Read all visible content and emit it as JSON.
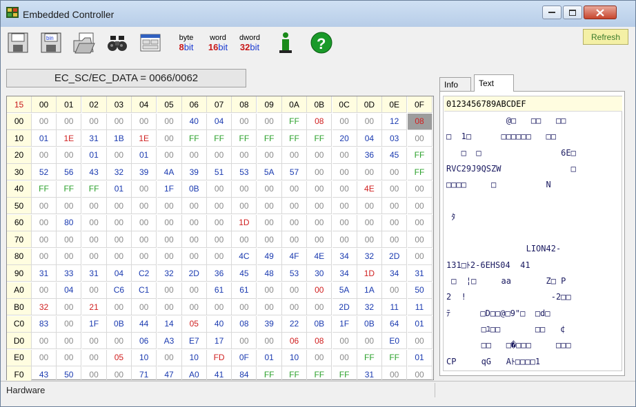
{
  "window": {
    "title": "Embedded Controller"
  },
  "toolbar": {
    "byte": {
      "top": "byte",
      "num": "8",
      "unit": "bit"
    },
    "word": {
      "top": "word",
      "num": "16",
      "unit": "bit"
    },
    "dword": {
      "top": "dword",
      "num": "32",
      "unit": "bit"
    },
    "refresh_label": "Refresh"
  },
  "ec_label": "EC_SC/EC_DATA = 0066/0062",
  "tabs": [
    {
      "label": "Info"
    },
    {
      "label": "Text"
    }
  ],
  "grid": {
    "corner": "15",
    "columns": [
      "00",
      "01",
      "02",
      "03",
      "04",
      "05",
      "06",
      "07",
      "08",
      "09",
      "0A",
      "0B",
      "0C",
      "0D",
      "0E",
      "0F"
    ],
    "rows": [
      {
        "label": "00",
        "cells": [
          "00",
          "00",
          "00",
          "00",
          "00",
          "00",
          "40",
          "04",
          "00",
          "00",
          "FF",
          "08",
          "00",
          "00",
          "12",
          "08"
        ]
      },
      {
        "label": "10",
        "cells": [
          "01",
          "1E",
          "31",
          "1B",
          "1E",
          "00",
          "FF",
          "FF",
          "FF",
          "FF",
          "FF",
          "FF",
          "20",
          "04",
          "03",
          "00"
        ]
      },
      {
        "label": "20",
        "cells": [
          "00",
          "00",
          "01",
          "00",
          "01",
          "00",
          "00",
          "00",
          "00",
          "00",
          "00",
          "00",
          "00",
          "36",
          "45",
          "FF"
        ]
      },
      {
        "label": "30",
        "cells": [
          "52",
          "56",
          "43",
          "32",
          "39",
          "4A",
          "39",
          "51",
          "53",
          "5A",
          "57",
          "00",
          "00",
          "00",
          "00",
          "FF"
        ]
      },
      {
        "label": "40",
        "cells": [
          "FF",
          "FF",
          "FF",
          "01",
          "00",
          "1F",
          "0B",
          "00",
          "00",
          "00",
          "00",
          "00",
          "00",
          "4E",
          "00",
          "00"
        ]
      },
      {
        "label": "50",
        "cells": [
          "00",
          "00",
          "00",
          "00",
          "00",
          "00",
          "00",
          "00",
          "00",
          "00",
          "00",
          "00",
          "00",
          "00",
          "00",
          "00"
        ]
      },
      {
        "label": "60",
        "cells": [
          "00",
          "80",
          "00",
          "00",
          "00",
          "00",
          "00",
          "00",
          "1D",
          "00",
          "00",
          "00",
          "00",
          "00",
          "00",
          "00"
        ]
      },
      {
        "label": "70",
        "cells": [
          "00",
          "00",
          "00",
          "00",
          "00",
          "00",
          "00",
          "00",
          "00",
          "00",
          "00",
          "00",
          "00",
          "00",
          "00",
          "00"
        ]
      },
      {
        "label": "80",
        "cells": [
          "00",
          "00",
          "00",
          "00",
          "00",
          "00",
          "00",
          "00",
          "4C",
          "49",
          "4F",
          "4E",
          "34",
          "32",
          "2D",
          "00"
        ]
      },
      {
        "label": "90",
        "cells": [
          "31",
          "33",
          "31",
          "04",
          "C2",
          "32",
          "2D",
          "36",
          "45",
          "48",
          "53",
          "30",
          "34",
          "1D",
          "34",
          "31"
        ]
      },
      {
        "label": "A0",
        "cells": [
          "00",
          "04",
          "00",
          "C6",
          "C1",
          "00",
          "00",
          "61",
          "61",
          "00",
          "00",
          "00",
          "5A",
          "1A",
          "00",
          "50"
        ]
      },
      {
        "label": "B0",
        "cells": [
          "32",
          "00",
          "21",
          "00",
          "00",
          "00",
          "00",
          "00",
          "00",
          "00",
          "00",
          "00",
          "2D",
          "32",
          "11",
          "11"
        ]
      },
      {
        "label": "C0",
        "cells": [
          "83",
          "00",
          "1F",
          "0B",
          "44",
          "14",
          "05",
          "40",
          "08",
          "39",
          "22",
          "0B",
          "1F",
          "0B",
          "64",
          "01"
        ]
      },
      {
        "label": "D0",
        "cells": [
          "00",
          "00",
          "00",
          "00",
          "06",
          "A3",
          "E7",
          "17",
          "00",
          "00",
          "06",
          "08",
          "00",
          "00",
          "E0",
          "00"
        ]
      },
      {
        "label": "E0",
        "cells": [
          "00",
          "00",
          "00",
          "05",
          "10",
          "00",
          "10",
          "FD",
          "0F",
          "01",
          "10",
          "00",
          "00",
          "FF",
          "FF",
          "01"
        ]
      },
      {
        "label": "F0",
        "cells": [
          "43",
          "50",
          "00",
          "00",
          "71",
          "47",
          "A0",
          "41",
          "84",
          "FF",
          "FF",
          "FF",
          "FF",
          "31",
          "00",
          "00"
        ]
      }
    ]
  },
  "text_panel": {
    "header": "0123456789ABCDEF",
    "lines": [
      "            @□   □□   □□",
      "□  1□      □□□□□□   □□",
      "   □  □                6E□",
      "RVC29J9QSZW              □",
      "□□□□     □          N",
      "",
      " ﾀ",
      "",
      "                LION42-",
      "131□ﾄ2-6EHS04  41",
      " □  ¦□     aa       Z□ P",
      "2  !                 -2□□",
      "ﾃ      □D□□@□9\"□  □d□",
      "       □ﾕ□□       □□   ¢",
      "       □□   □�□□□     □□□",
      "CP     qG   Aﾄ□□□□1"
    ]
  },
  "status": {
    "text": "Hardware"
  },
  "colors": {
    "zero": "#8a8a8a",
    "value": "#1a3ab0",
    "ff": "#2aa02a",
    "special": "#d02020",
    "header_bg": "#fffde0",
    "selected_bg": "#9d9d9d"
  },
  "special_cells": [
    "00-0B",
    "00-0F",
    "10-01",
    "10-04",
    "40-0D",
    "60-08",
    "90-0D",
    "A0-0B",
    "B0-00",
    "B0-02",
    "C0-06",
    "D0-0A",
    "D0-0B",
    "E0-03",
    "E0-07"
  ],
  "selected_cell": "00-0F"
}
